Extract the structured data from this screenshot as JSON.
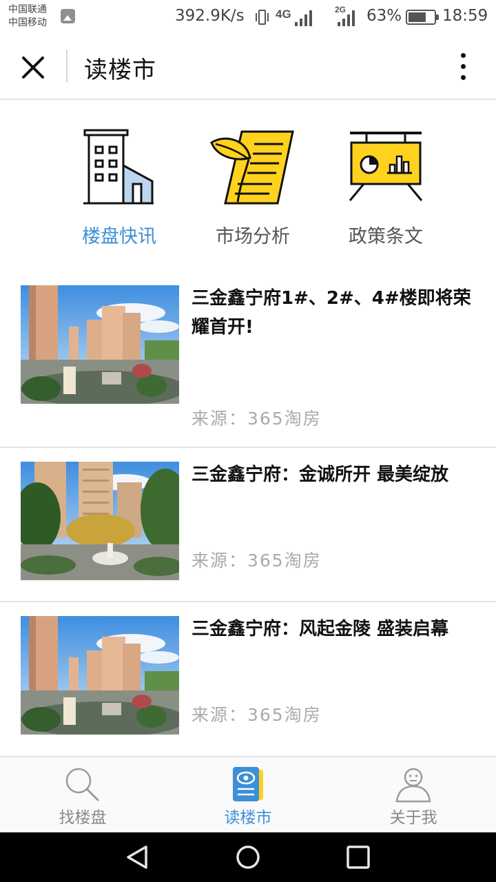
{
  "status_bar": {
    "carrier_1": "中国联通",
    "carrier_2": "中国移动",
    "net_speed": "392.9K/s",
    "network_1": "4G",
    "network_2": "2G",
    "battery": "63%",
    "time": "18:59"
  },
  "header": {
    "title": "读楼市",
    "close_icon": "close-icon",
    "more_icon": "more-vertical-icon"
  },
  "categories": [
    {
      "label": "楼盘快讯",
      "icon": "building-icon",
      "active": true
    },
    {
      "label": "市场分析",
      "icon": "document-leaf-icon",
      "active": false
    },
    {
      "label": "政策条文",
      "icon": "billboard-chart-icon",
      "active": false
    }
  ],
  "news": [
    {
      "title": "三金鑫宁府1#、2#、4#楼即将荣耀首开!",
      "source": "来源：365淘房",
      "thumbnail": "building-rendering-image"
    },
    {
      "title": "三金鑫宁府：金诚所开 最美绽放",
      "source": "来源：365淘房",
      "thumbnail": "garden-rendering-image"
    },
    {
      "title": "三金鑫宁府：风起金陵 盛装启幕",
      "source": "来源：365淘房",
      "thumbnail": "building-rendering-image"
    }
  ],
  "tabs": [
    {
      "label": "找楼盘",
      "icon": "search-icon",
      "active": false
    },
    {
      "label": "读楼市",
      "icon": "reading-icon",
      "active": true
    },
    {
      "label": "关于我",
      "icon": "user-icon",
      "active": false
    }
  ],
  "colors": {
    "accent": "#3d8fd6",
    "yellow": "#ffd21e",
    "muted_text": "#aaaaaa"
  }
}
